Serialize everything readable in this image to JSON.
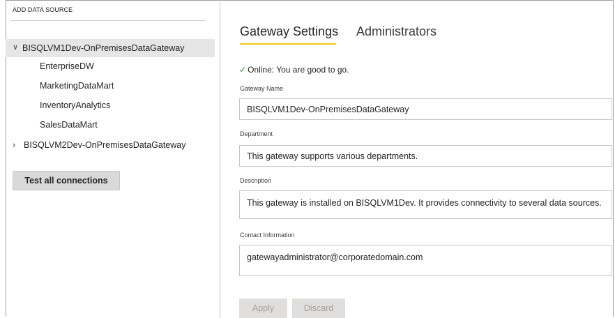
{
  "sidebar": {
    "header": "ADD DATA SOURCE",
    "gateways": [
      {
        "name": "BISQLVM1Dev-OnPremisesDataGateway",
        "expanded": true,
        "chevron": "chevron-down-icon",
        "data_sources": [
          "EnterpriseDW",
          "MarketingDataMart",
          "InventoryAnalytics",
          "SalesDataMart"
        ]
      },
      {
        "name": "BISQLVM2Dev-OnPremisesDataGateway",
        "expanded": false,
        "chevron": "chevron-right-icon"
      }
    ],
    "test_button": "Test all connections"
  },
  "tabs": [
    {
      "label": "Gateway Settings",
      "active": true
    },
    {
      "label": "Administrators",
      "active": false
    }
  ],
  "status": {
    "icon": "check-icon",
    "text": "Online: You are good to go."
  },
  "form": {
    "gateway_name": {
      "label": "Gateway Name",
      "value": "BISQLVM1Dev-OnPremisesDataGateway"
    },
    "department": {
      "label": "Department",
      "value": "This gateway supports various departments."
    },
    "description": {
      "label": "Description",
      "value": "This gateway is installed on BISQLVM1Dev. It provides connectivity to several data sources."
    },
    "contact": {
      "label": "Contact Information",
      "value": "gatewayadministrator@corporatedomain.com"
    }
  },
  "buttons": {
    "apply": "Apply",
    "discard": "Discard"
  },
  "colors": {
    "accent": "#f2c811",
    "selected_bg": "#e6e6e6",
    "online": "#2e8b3a"
  }
}
